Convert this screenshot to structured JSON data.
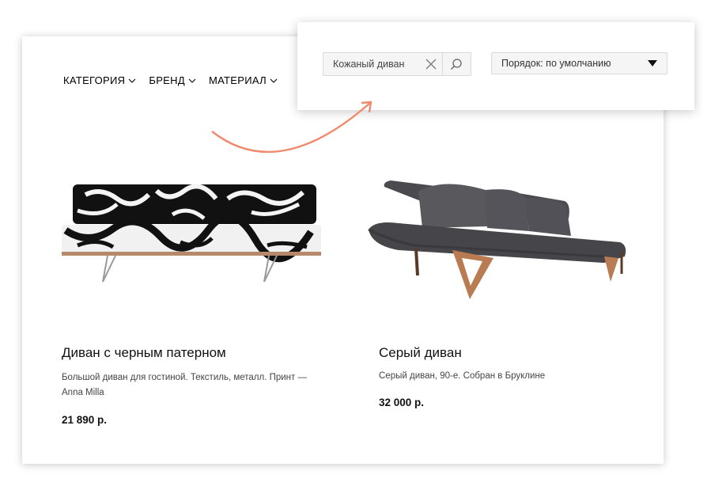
{
  "filters": [
    {
      "label": "КАТЕГОРИЯ"
    },
    {
      "label": "БРЕНД"
    },
    {
      "label": "МАТЕРИАЛ"
    }
  ],
  "search": {
    "value": "Кожаный диван",
    "clear_icon": "close-icon",
    "submit_icon": "search-icon"
  },
  "sort": {
    "selected": "Порядок: по умолчанию",
    "icon": "triangle-down-icon"
  },
  "accent_color": "#f08a6c",
  "products": [
    {
      "name": "Диван с черным патерном",
      "description": "Большой диван для гостиной. Текстиль, металл. Принт — Anna Milla",
      "price": "21 890 р.",
      "image": "patterned-sofa-image"
    },
    {
      "name": "Серый диван",
      "description": "Серый диван, 90-е. Собран в Бруклине",
      "price": "32 000 р.",
      "image": "grey-sofa-image"
    }
  ]
}
